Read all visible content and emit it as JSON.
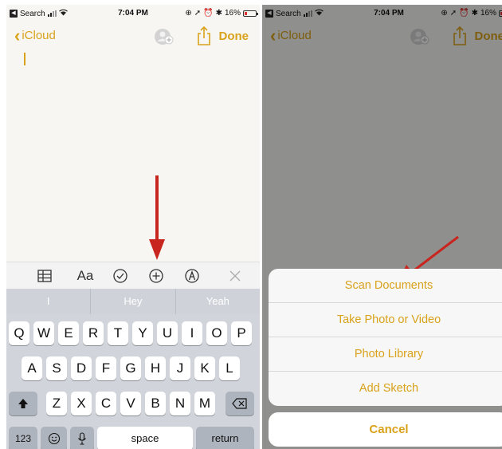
{
  "status_bar": {
    "back_app": "Search",
    "time": "7:04 PM",
    "battery": "16%"
  },
  "nav": {
    "back_label": "iCloud",
    "done_label": "Done"
  },
  "toolbar": {
    "text_style_label": "Aa"
  },
  "predictions": [
    "I",
    "Hey",
    "Yeah"
  ],
  "keyboard": {
    "row1": [
      "Q",
      "W",
      "E",
      "R",
      "T",
      "Y",
      "U",
      "I",
      "O",
      "P"
    ],
    "row2": [
      "A",
      "S",
      "D",
      "F",
      "G",
      "H",
      "J",
      "K",
      "L"
    ],
    "row3": [
      "Z",
      "X",
      "C",
      "V",
      "B",
      "N",
      "M"
    ],
    "numbers_label": "123",
    "space_label": "space",
    "return_label": "return"
  },
  "action_sheet": {
    "items": [
      "Scan Documents",
      "Take Photo or Video",
      "Photo Library",
      "Add Sketch"
    ],
    "cancel_label": "Cancel"
  },
  "colors": {
    "accent": "#d9a21b",
    "arrow": "#c8251f"
  }
}
